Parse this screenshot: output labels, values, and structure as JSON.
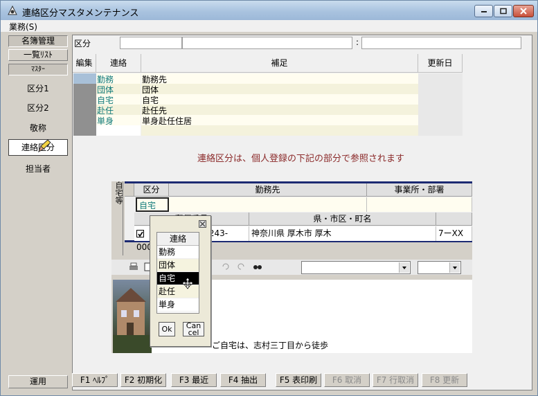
{
  "window": {
    "title": "連絡区分マスタメンテナンス",
    "menu": "業務(S)"
  },
  "sidebar": {
    "top_buttons": [
      "名簿管理",
      "一覧ﾘｽﾄ",
      "ﾏｽﾀｰ"
    ],
    "items": [
      "区分1",
      "区分2",
      "敬称",
      "連絡区分",
      "担当者"
    ],
    "bottom": "運用"
  },
  "fields": {
    "kubun_label": "区分",
    "colon": ":"
  },
  "grid": {
    "headers": [
      "編集",
      "連絡",
      "補足",
      "更新日"
    ],
    "rows": [
      {
        "code": "勤務",
        "supplement": "勤務先"
      },
      {
        "code": "団体",
        "supplement": "団体"
      },
      {
        "code": "自宅",
        "supplement": "自宅"
      },
      {
        "code": "赴任",
        "supplement": "赴任先"
      },
      {
        "code": "単身",
        "supplement": "単身赴任住居"
      }
    ]
  },
  "notice": "連絡区分は、個人登録の下記の部分で参照されます",
  "panel": {
    "side_label": "自宅等",
    "headers1": [
      "区分",
      "勤務先",
      "事業所・部署"
    ],
    "kubun_value": "自宅",
    "headers2": [
      "郵便番号",
      "県・市区・町名"
    ],
    "postal": "243-0007",
    "address": "神奈川県 厚木市 厚木",
    "extra": "7ーXX",
    "memo": "ご自宅は、志村三丁目から徒歩"
  },
  "popup": {
    "header": "連絡",
    "items": [
      "勤務",
      "団体",
      "自宅",
      "赴任",
      "単身"
    ],
    "ok": "Ok",
    "cancel_line1": "Can",
    "cancel_line2": "cel"
  },
  "fkeys": [
    {
      "label": "F1 ﾍﾙﾌﾟ",
      "enabled": true
    },
    {
      "label": "F2 初期化",
      "enabled": true
    },
    {
      "label": "F3 最近",
      "enabled": true
    },
    {
      "label": "F4 抽出",
      "enabled": true
    },
    {
      "label": "F5 表印刷",
      "enabled": true
    },
    {
      "label": "F6 取消",
      "enabled": false
    },
    {
      "label": "F7 行取消",
      "enabled": false
    },
    {
      "label": "F8 更新",
      "enabled": false
    }
  ],
  "colors": {
    "accent_text": "#117a7a",
    "notice": "#8b2a2a",
    "table_border": "#1c2a72"
  }
}
